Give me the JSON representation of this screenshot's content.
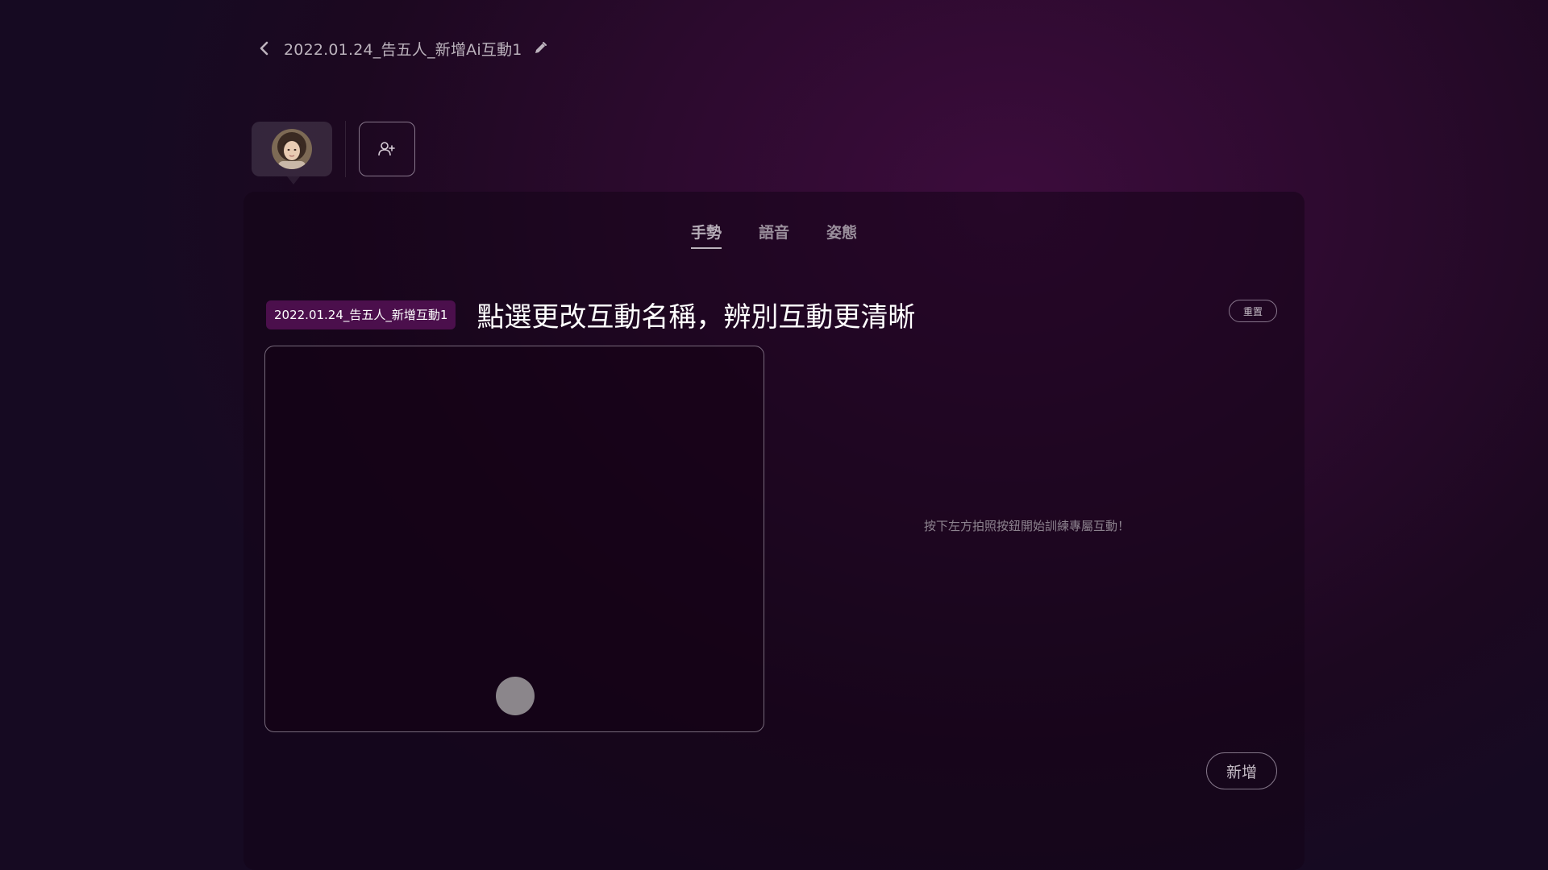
{
  "header": {
    "title": "2022.01.24_告五人_新增Ai互動1",
    "back_icon": "chevron-left-icon",
    "edit_icon": "pencil-icon"
  },
  "characters": {
    "add_icon": "add-user-icon"
  },
  "tabs": [
    {
      "label": "手勢",
      "active": true
    },
    {
      "label": "語音",
      "active": false
    },
    {
      "label": "姿態",
      "active": false
    }
  ],
  "interaction": {
    "name": "2022.01.24_告五人_新增互動1",
    "hint": "點選更改互動名稱，辨別互動更清晰",
    "reset_label": "重置",
    "empty_hint": "按下左方拍照按鈕開始訓練專屬互動！",
    "add_label": "新增"
  },
  "colors": {
    "background": "#2c0a2e",
    "accent_chip": "#4b0f4c",
    "capture_button": "#8b868b"
  }
}
